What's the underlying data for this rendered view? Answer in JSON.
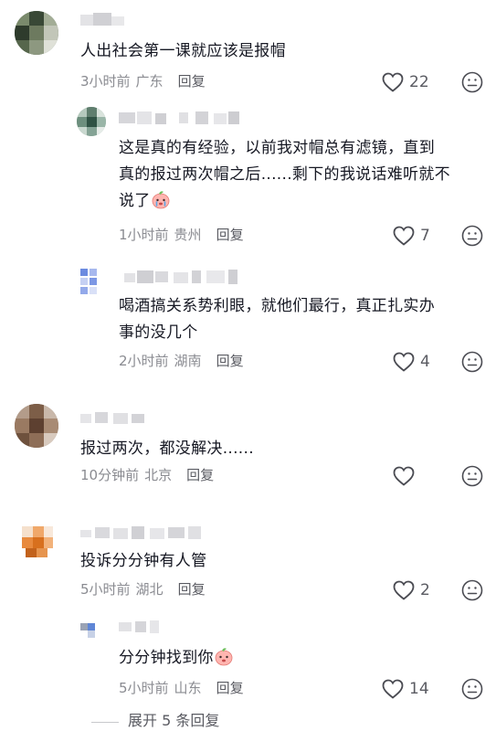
{
  "comments": [
    {
      "text_lines": [
        "人出社会第一课就应该是报帽"
      ],
      "time": "3小时前",
      "location": "广东",
      "reply_label": "回复",
      "likes": "22",
      "replies": [
        {
          "text_lines": [
            "这是真的有经验，以前我对帽总有滤镜，直到",
            "真的报过两次帽之后......剩下的我说话难听就不",
            "说了"
          ],
          "emoji": "crying-peach-emoji",
          "time": "1小时前",
          "location": "贵州",
          "reply_label": "回复",
          "likes": "7"
        },
        {
          "text_lines": [
            "喝酒搞关系势利眼，就他们最行，真正扎实办",
            "事的没几个"
          ],
          "time": "2小时前",
          "location": "湖南",
          "reply_label": "回复",
          "likes": "4"
        }
      ]
    },
    {
      "text_lines": [
        "报过两次，都没解决......"
      ],
      "time": "10分钟前",
      "location": "北京",
      "reply_label": "回复",
      "likes": ""
    },
    {
      "text_lines": [
        "投诉分分钟有人管"
      ],
      "time": "5小时前",
      "location": "湖北",
      "reply_label": "回复",
      "likes": "2",
      "replies": [
        {
          "text_lines": [
            "分分钟找到你"
          ],
          "emoji": "peach-emoji",
          "time": "5小时前",
          "location": "山东",
          "reply_label": "回复",
          "likes": "14"
        }
      ]
    }
  ],
  "expand_label": "展开 5 条回复",
  "colors": {
    "text": "#161823",
    "meta": "#8a8b91",
    "icon": "#4a4b52"
  }
}
